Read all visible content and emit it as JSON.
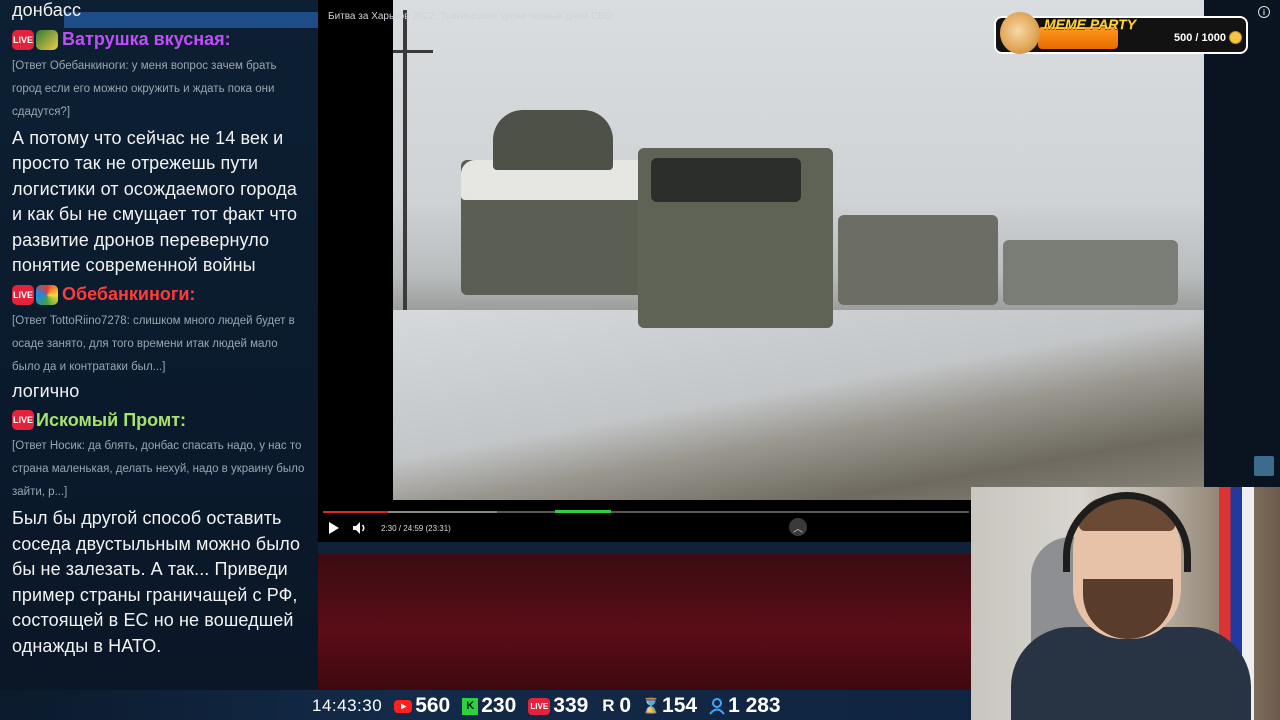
{
  "chat": {
    "top_fragment": "донбасс",
    "messages": [
      {
        "author": "Ватрушка вкусная:",
        "author_color": "#c04df9",
        "reply": "[Ответ Обебанкиноги: у меня вопрос зачем брать город если его можно окружить и ждать пока они сдадутся?]",
        "text": "А потому что сейчас не 14 век и просто так не отрежешь пути логистики от осождаемого города и как бы не смущает тот факт что развитие дронов перевернуло понятие современной войны"
      },
      {
        "author": "Обебанкиноги:",
        "author_color": "#ff3b3b",
        "reply": "[Ответ TottoRiino7278: слишком много людей будет в осаде занято, для того времени итак людей мало было да и контратаки был...]",
        "text": "логично"
      },
      {
        "author": "Искомый Промт:",
        "author_color": "#a7e36b",
        "reply": "[Ответ Носик: да блять, донбас спасать надо, у нас то страна маленькая, делать нехуй, надо в украину было зайти, р...]",
        "text": "Был бы другой способ оставить соседа двустыльным можно было бы не залезать. А так... Приведи пример страны граничащей с РФ, состоящей в ЕС но не вошедшей однажды в НАТО."
      }
    ],
    "live_label": "LIVE"
  },
  "video": {
    "title": "Битва за Харьков 2022. Трагические уроки первых дней СВО",
    "time_display": "2:30 / 24:59 (23:31)",
    "progress": 0.1,
    "buffered": 0.27
  },
  "meme_party": {
    "title": "MEME PARTY",
    "score": "500 / 1000"
  },
  "stats": {
    "clock": "14:43:30",
    "youtube": "560",
    "kick": "230",
    "vk_live": "339",
    "rutube": "0",
    "twitch": "154",
    "total": "1 283",
    "vk_live_label": "LIVE",
    "rutube_label": "R",
    "kick_label": "K"
  },
  "colors": {
    "chat_bg": "#0d1f33",
    "banner_red": "#5a0d17",
    "accent_blue": "#1d4c86",
    "progress_red": "#e02525",
    "green": "#2bd13f"
  }
}
